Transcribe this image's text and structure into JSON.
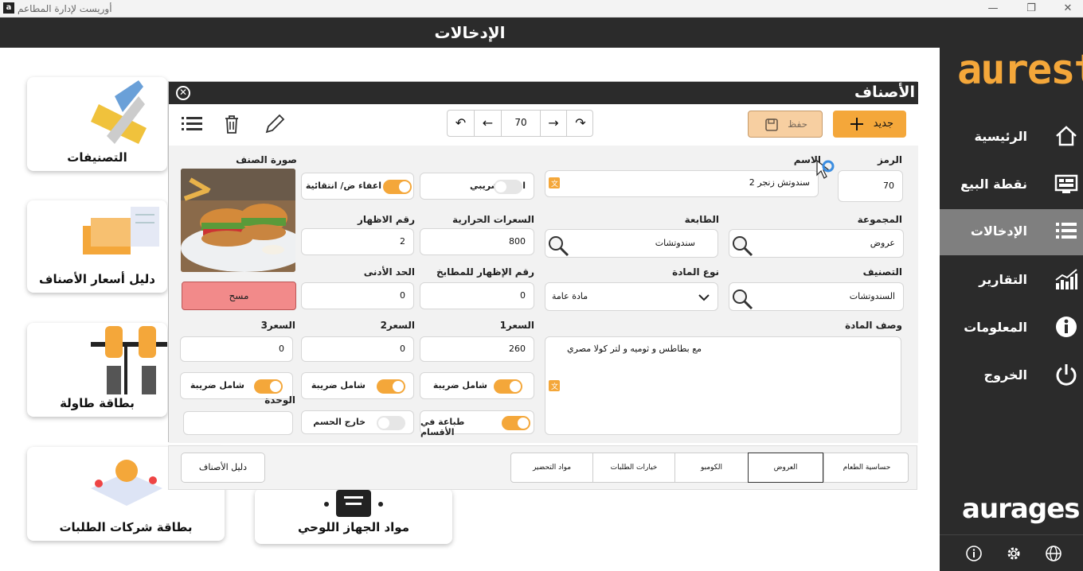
{
  "app": {
    "window_title": "أوريست لإدارة المطاعم",
    "icon_letter": "a"
  },
  "header": {
    "title": "الإدخالات"
  },
  "sidebar": {
    "logo": "aurest",
    "brand": "aurages",
    "items": [
      {
        "label": "الرئيسية",
        "icon": "home-icon"
      },
      {
        "label": "نقطة البيع",
        "icon": "pos-icon"
      },
      {
        "label": "الإدخالات",
        "icon": "list-icon",
        "active": true
      },
      {
        "label": "التقارير",
        "icon": "chart-icon"
      },
      {
        "label": "المعلومات",
        "icon": "info-icon"
      },
      {
        "label": "الخروج",
        "icon": "power-icon"
      }
    ],
    "footer_icons": [
      "info-circle-icon",
      "gear-icon",
      "globe-icon"
    ]
  },
  "tiles": [
    {
      "label": "التصنيفات"
    },
    {
      "label": "دليل أسعار الأصناف"
    },
    {
      "label": "بطاقة طاولة"
    },
    {
      "label": "بطاقة شركات الطلبات"
    },
    {
      "label": "مواد الجهاز اللوحي"
    }
  ],
  "dialog": {
    "title": "الأصناف",
    "toolbar": {
      "new_label": "جديد",
      "save_label": "حفظ",
      "record": "70"
    },
    "form": {
      "code_label": "الرمز",
      "code": "70",
      "name_label": "الاسم",
      "name": "2 سندوتش زنجر",
      "tax_exempt_label": "اعفاء ضريبي",
      "optional_exempt_label": "اعفاء ض/ انتقائية",
      "image_label": "صورة الصنف",
      "group_label": "المجموعة",
      "group": "عروض",
      "printer_label": "الطابعة",
      "printer": "سندوتشات",
      "calories_label": "السعرات الحرارية",
      "calories": "800",
      "display_no_label": "رقم الاظهار",
      "display_no": "2",
      "category_label": "التصنيف",
      "category": "السندوتشات",
      "material_type_label": "نوع المادة",
      "material_type": "مادة عامة",
      "kitchen_display_label": "رقم الإظهار للمطابخ",
      "kitchen_display": "0",
      "min_label": "الحد الأدنى",
      "min": "0",
      "clear_label": "مسح",
      "description_label": "وصف المادة",
      "description": "مع بطاطس و ثوميه و لتر كولا مصري",
      "price1_label": "السعر1",
      "price1": "260",
      "price2_label": "السعر2",
      "price2": "0",
      "price3_label": "السعر3",
      "price3": "0",
      "tax_incl_label": "شامل ضريبة",
      "unit_label": "الوحدة",
      "print_sections_label": "طباعة في الأقسام",
      "no_discount_label": "خارج الحسم"
    }
  },
  "bottom": {
    "guide_label": "دليل الأصناف",
    "tabs": [
      "حساسية الطعام",
      "العروض",
      "الكومبو",
      "خيارات الطلبات",
      "مواد التحضير"
    ]
  }
}
